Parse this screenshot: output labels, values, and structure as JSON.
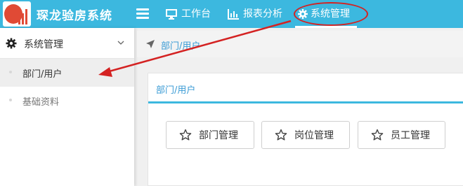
{
  "app": {
    "title": "琛龙验房系统"
  },
  "nav": {
    "items": [
      {
        "label": "工作台",
        "icon": "monitor-icon"
      },
      {
        "label": "报表分析",
        "icon": "bar-chart-icon"
      },
      {
        "label": "系统管理",
        "icon": "gear-icon",
        "active": true
      }
    ]
  },
  "sidebar": {
    "header": "系统管理",
    "items": [
      {
        "label": "部门/用户",
        "active": true
      },
      {
        "label": "基础资料",
        "active": false
      }
    ]
  },
  "breadcrumb": {
    "current": "部门/用户"
  },
  "panel": {
    "title": "部门/用户",
    "buttons": [
      {
        "label": "部门管理",
        "icon": "star-icon"
      },
      {
        "label": "岗位管理",
        "icon": "star-icon"
      },
      {
        "label": "员工管理",
        "icon": "star-icon"
      }
    ]
  },
  "colors": {
    "topbar": "#3cb8df",
    "link": "#3a9bd5",
    "annotation": "#d42222",
    "logo": "#e04a35"
  },
  "annotations": [
    {
      "type": "ellipse",
      "target": "nav-system-management"
    },
    {
      "type": "arrow",
      "from": "nav-system-management",
      "to": "sidebar-item-dept-user"
    }
  ]
}
